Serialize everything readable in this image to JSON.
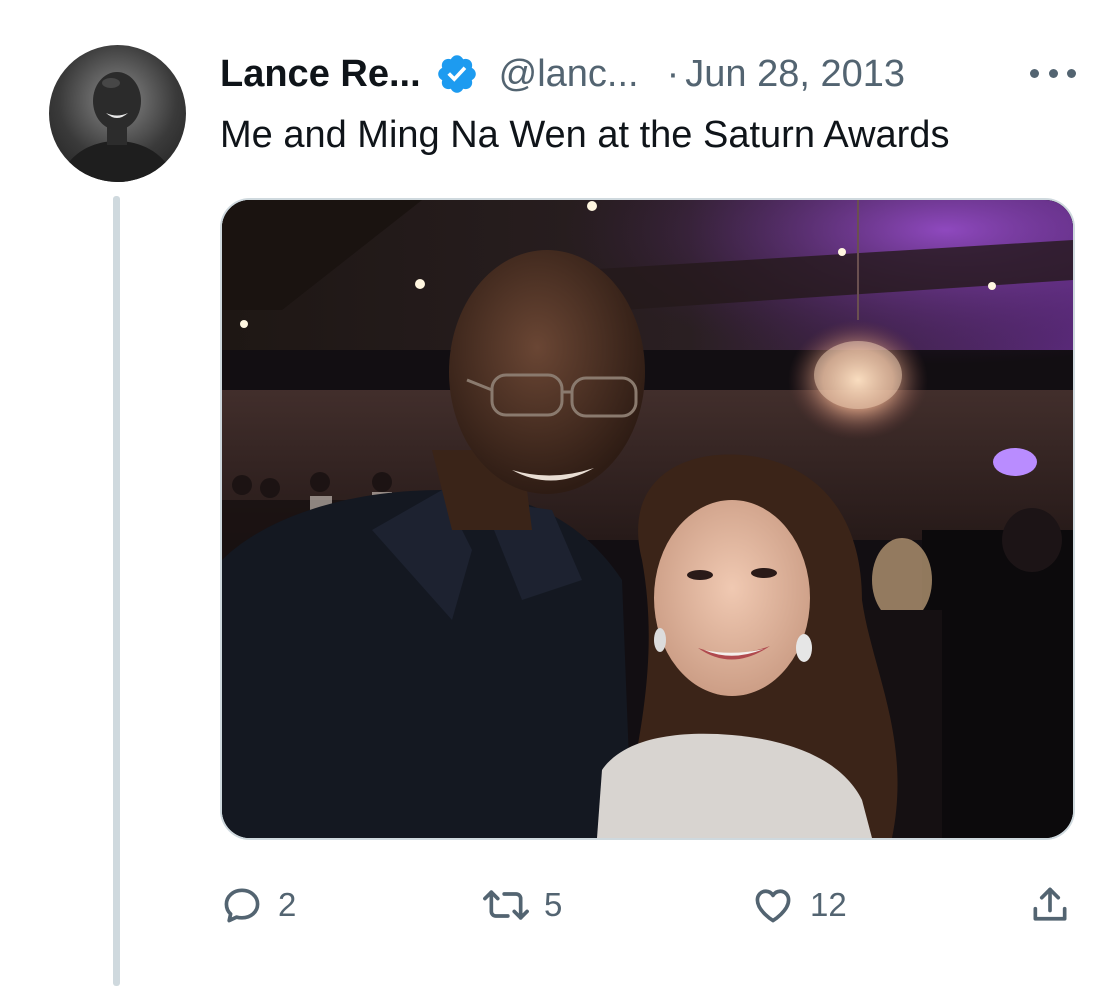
{
  "author": {
    "display_name": "Lance Re...",
    "handle": "@lanc...",
    "verified_icon": "verified-badge-icon",
    "avatar_description_icon": "avatar"
  },
  "meta": {
    "separator": "·",
    "date": "Jun 28, 2013"
  },
  "menu": {
    "icon": "more-options-icon"
  },
  "tweet": {
    "text": "Me and Ming Na Wen at the Saturn Awards"
  },
  "actions": {
    "reply": {
      "icon": "reply-icon",
      "count": "2"
    },
    "retweet": {
      "icon": "retweet-icon",
      "count": "5"
    },
    "like": {
      "icon": "heart-icon",
      "count": "12"
    },
    "share": {
      "icon": "share-icon"
    }
  },
  "colors": {
    "text_primary": "#0f1419",
    "text_secondary": "#536471",
    "verified_blue": "#1d9bf0",
    "thread_line": "#cfd9de"
  }
}
